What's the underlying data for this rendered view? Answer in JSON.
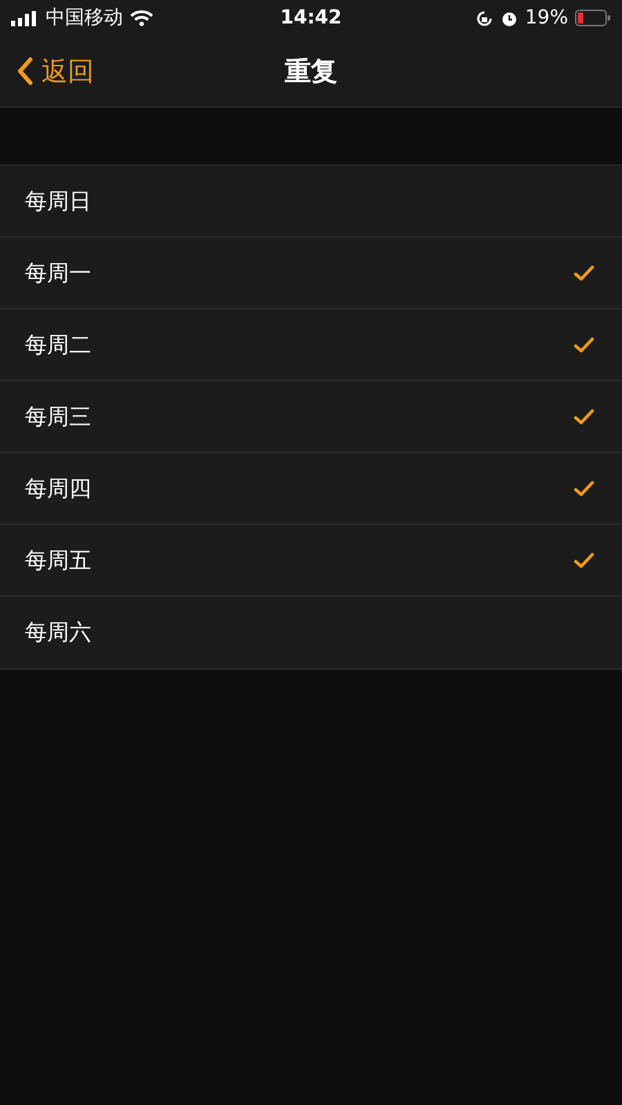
{
  "status_bar": {
    "carrier": "中国移动",
    "time": "14:42",
    "battery": "19%"
  },
  "nav": {
    "back": "返回",
    "title": "重复"
  },
  "days": [
    {
      "label": "每周日",
      "checked": false
    },
    {
      "label": "每周一",
      "checked": true
    },
    {
      "label": "每周二",
      "checked": true
    },
    {
      "label": "每周三",
      "checked": true
    },
    {
      "label": "每周四",
      "checked": true
    },
    {
      "label": "每周五",
      "checked": true
    },
    {
      "label": "每周六",
      "checked": false
    }
  ]
}
